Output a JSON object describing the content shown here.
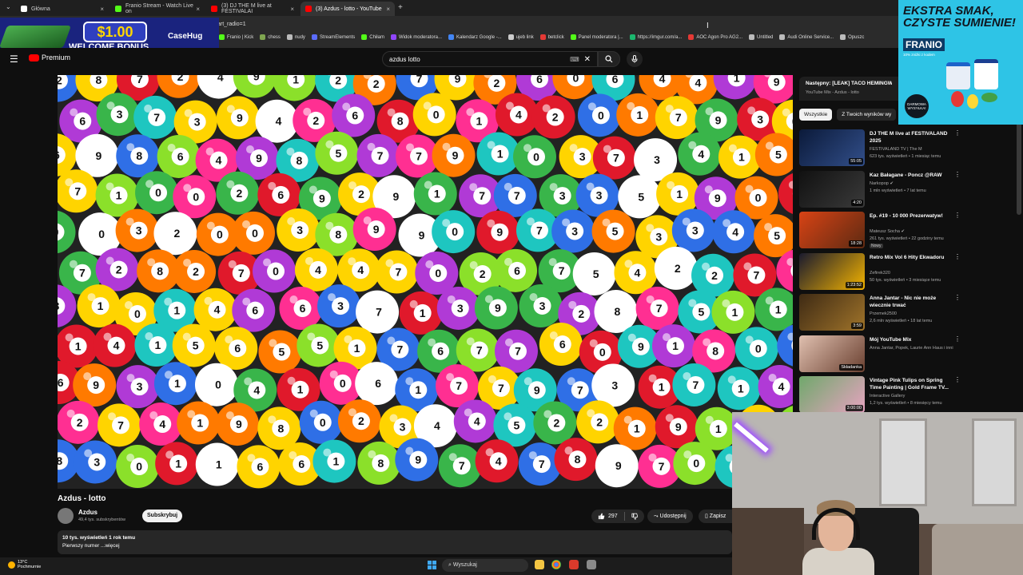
{
  "browser": {
    "tabs": [
      {
        "label": "Główna",
        "color": "#ffffff",
        "active": false
      },
      {
        "label": "Franio Stream - Watch Live on",
        "color": "#53fc18",
        "active": false
      },
      {
        "label": "(3) DJ THE M live at FESTIVALAI",
        "color": "#ff0000",
        "active": false
      },
      {
        "label": "(3) Azdus - lotto - YouTube",
        "color": "#ff0000",
        "active": true
      }
    ],
    "new_tab": "+",
    "url_fragment": "art_radio=1",
    "bookmarks": [
      {
        "label": "Franio | Kick",
        "color": "#53fc18"
      },
      {
        "label": "chess",
        "color": "#7fa650"
      },
      {
        "label": "nudy",
        "color": "#bbbbbb"
      },
      {
        "label": "StreamElements",
        "color": "#5b6cff"
      },
      {
        "label": "Chiłam",
        "color": "#53fc18"
      },
      {
        "label": "Widok moderatora...",
        "color": "#9146ff"
      },
      {
        "label": "Kalendarz Google -...",
        "color": "#4285f4"
      },
      {
        "label": "ujeb link",
        "color": "#cccccc"
      },
      {
        "label": "betclick",
        "color": "#e53935"
      },
      {
        "label": "Panel moderatora |...",
        "color": "#53fc18"
      },
      {
        "label": "https://imgur.com/a...",
        "color": "#1bb76e"
      },
      {
        "label": "AOC Agon Pro AG2...",
        "color": "#e53935"
      },
      {
        "label": "Untitled",
        "color": "#bbbbbb"
      },
      {
        "label": "Audi Online Service...",
        "color": "#bbbbbb"
      },
      {
        "label": "Opuszc",
        "color": "#bbbbbb"
      }
    ]
  },
  "ad_left": {
    "price": "$1.00",
    "bonus": "WELCOME BONUS",
    "brand": "CaseHug"
  },
  "ad_right": {
    "headline": "EKSTRA SMAK, CZYSTE SUMIENIE!",
    "brand": "FRANIO",
    "tag": "10% zniżki z kodem",
    "stamp": "DARMOWA WYSYŁKA!"
  },
  "youtube": {
    "logo_text": "Premium",
    "search": {
      "value": "azdus lotto",
      "kbd": "⌨",
      "clear": "✕"
    },
    "video": {
      "title": "Azdus - lotto",
      "channel": "Azdus",
      "subscribers": "49,4 tys. subskrybentów",
      "subscribe_label": "Subskrybuj",
      "likes": "297",
      "share_label": "Udostępnij",
      "save_label": "Zapisz",
      "desc_views": "10 tys. wyświetleń  1 rok temu",
      "desc_text": "Pierwszy numer ...więcej"
    },
    "next_up": {
      "title": "Następny: [LEAK] TACO HEMINGWAY",
      "subtitle": "YouTube Mix - Azdus - lotto"
    },
    "chips": [
      {
        "label": "Wszystkie",
        "active": true
      },
      {
        "label": "Z Twoich wyników wy",
        "active": false
      }
    ],
    "recommendations": [
      {
        "title": "DJ THE M live at FESTIVALAND 2025",
        "channel": "FESTIVALAND TV | The M",
        "meta": "623 tys. wyświetleń • 1 miesiąc temu",
        "duration": "55:05",
        "badge": "",
        "colors": [
          "#0b1a3a",
          "#324f8a"
        ]
      },
      {
        "title": "Kaz Bałagane - Poncz @RAW",
        "channel": "Narkopop ✔",
        "meta": "1 mln wyświetleń • 7 lat temu",
        "duration": "4:20",
        "badge": "",
        "colors": [
          "#111111",
          "#3a3a3a"
        ]
      },
      {
        "title": "Ep. #19 - 10 000 Prezerwatyw!",
        "channel": "Mateusz Socha ✔",
        "meta": "261 tys. wyświetleń • 22 godziny temu",
        "duration": "18:28",
        "badge": "Nowy",
        "colors": [
          "#d84315",
          "#5d2a12"
        ]
      },
      {
        "title": "Retro Mix Vol 6 Hity Ekwadoru",
        "channel": "Zefirek320",
        "meta": "50 tys. wyświetleń • 3 miesiące temu",
        "duration": "1:23:52",
        "badge": "",
        "colors": [
          "#1a1a2e",
          "#f4b400"
        ]
      },
      {
        "title": "Anna Jantar - Nic nie może wiecznie trwać",
        "channel": "Przemek2500",
        "meta": "2,6 mln wyświetleń • 18 lat temu",
        "duration": "3:59",
        "badge": "",
        "colors": [
          "#3e2a14",
          "#a0742a"
        ]
      },
      {
        "title": "Mój YouTube Mix",
        "channel": "Anna Jantar, Popek, Laurie Ann Haus i inni",
        "meta": "",
        "duration": "Składanka",
        "badge": "",
        "colors": [
          "#e0c0b0",
          "#6a4030"
        ]
      },
      {
        "title": "Vintage Pink Tulips on Spring Time Painting | Gold Frame TV...",
        "channel": "Interactive Gallery",
        "meta": "1,2 tys. wyświetleń • 8 miesięcy temu",
        "duration": "3:00:00",
        "badge": "",
        "colors": [
          "#6fa86b",
          "#e7a3c0"
        ]
      }
    ]
  },
  "taskbar": {
    "weather_temp": "13°C",
    "weather_desc": "Pochmurnie",
    "search_label": "Wyszukaj"
  }
}
